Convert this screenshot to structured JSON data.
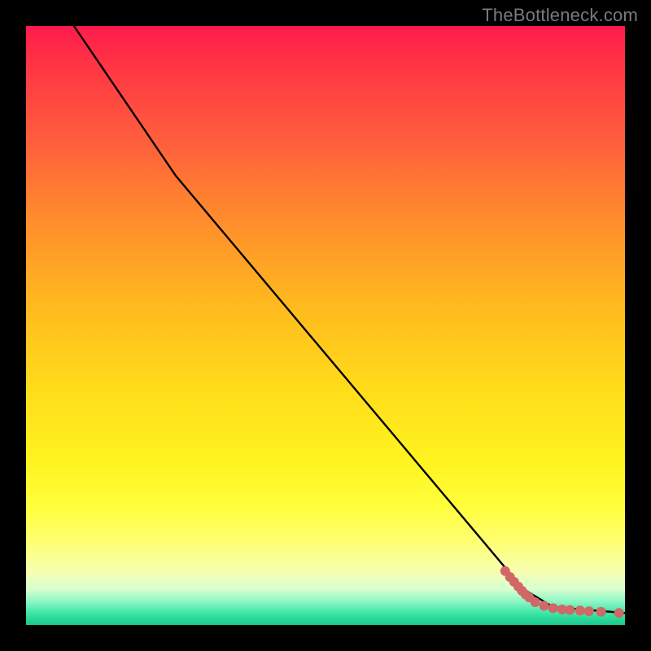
{
  "watermark": "TheBottleneck.com",
  "chart_data": {
    "type": "line",
    "title": "",
    "xlabel": "",
    "ylabel": "",
    "xlim": [
      0,
      100
    ],
    "ylim": [
      0,
      100
    ],
    "grid": false,
    "legend": false,
    "line_points": [
      {
        "x": 8,
        "y": 100
      },
      {
        "x": 25,
        "y": 75
      },
      {
        "x": 83,
        "y": 6
      },
      {
        "x": 88,
        "y": 3
      },
      {
        "x": 100,
        "y": 2
      }
    ],
    "scatter_points": [
      {
        "x": 80.0,
        "y": 9.0
      },
      {
        "x": 80.8,
        "y": 8.0
      },
      {
        "x": 81.5,
        "y": 7.2
      },
      {
        "x": 82.2,
        "y": 6.4
      },
      {
        "x": 82.8,
        "y": 5.7
      },
      {
        "x": 83.4,
        "y": 5.1
      },
      {
        "x": 84.0,
        "y": 4.6
      },
      {
        "x": 85.0,
        "y": 3.8
      },
      {
        "x": 86.5,
        "y": 3.2
      },
      {
        "x": 88.0,
        "y": 2.8
      },
      {
        "x": 89.5,
        "y": 2.6
      },
      {
        "x": 90.8,
        "y": 2.5
      },
      {
        "x": 92.5,
        "y": 2.4
      },
      {
        "x": 94.0,
        "y": 2.3
      },
      {
        "x": 96.0,
        "y": 2.2
      },
      {
        "x": 99.0,
        "y": 2.0
      }
    ],
    "colors": {
      "line": "#000000",
      "scatter": "#d16767"
    }
  }
}
